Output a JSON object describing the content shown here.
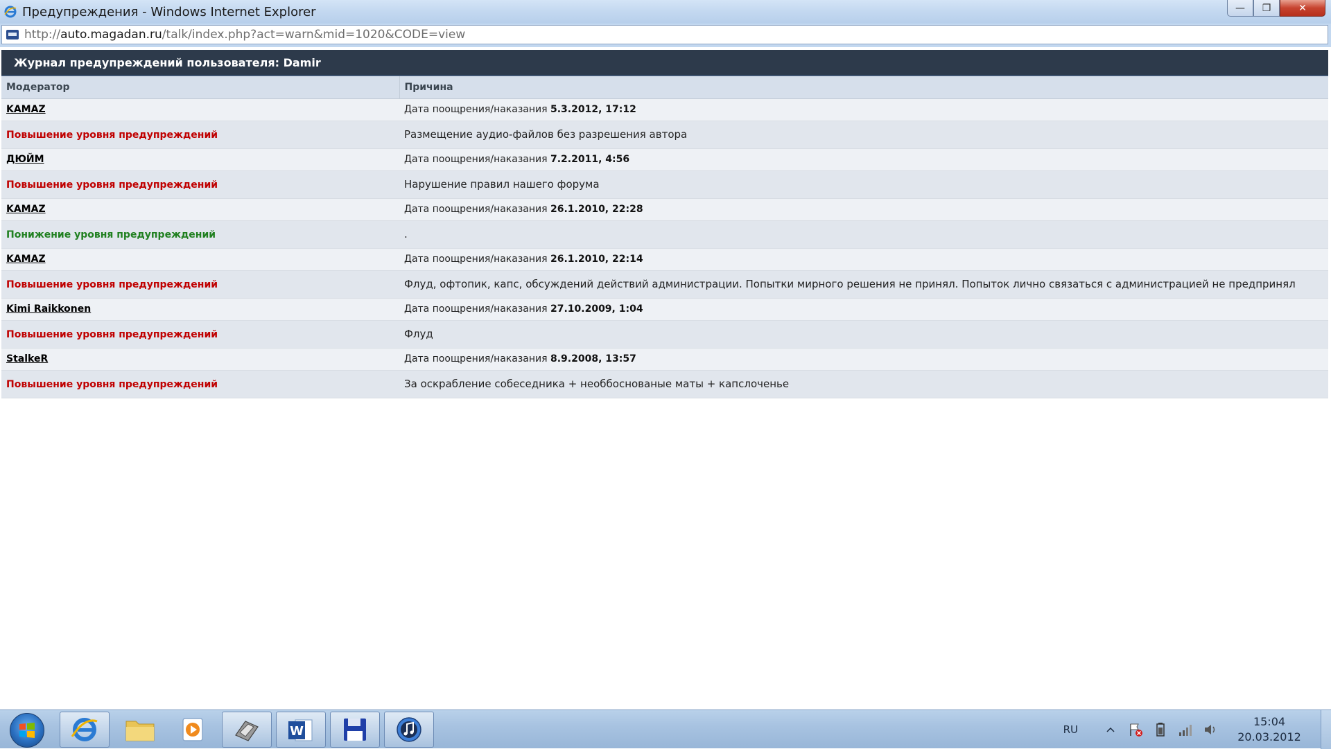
{
  "window": {
    "title": "Предупреждения - Windows Internet Explorer",
    "controls": {
      "minimize": "—",
      "maximize": "❐",
      "close": "✕"
    }
  },
  "address": {
    "prefix": "http://",
    "host": "auto.magadan.ru",
    "path": "/talk/index.php?act=warn&mid=1020&CODE=view"
  },
  "log": {
    "title": "Журнал предупреждений пользователя: Damir",
    "columns": {
      "moderator": "Модератор",
      "reason": "Причина"
    },
    "date_label": "Дата поощрения/наказания",
    "entries": [
      {
        "moderator": "KAMAZ",
        "date": "5.3.2012, 17:12",
        "action": "Повышение уровня предупреждений",
        "reason": "Размещение аудио-файлов без разрешения автора"
      },
      {
        "moderator": "ДЮЙМ",
        "date": "7.2.2011, 4:56",
        "action": "Повышение уровня предупреждений",
        "reason": "Нарушение правил нашего форума"
      },
      {
        "moderator": "KAMAZ",
        "date": "26.1.2010, 22:28",
        "action": "Понижение уровня предупреждений",
        "reason": "."
      },
      {
        "moderator": "KAMAZ",
        "date": "26.1.2010, 22:14",
        "action": "Повышение уровня предупреждений",
        "reason": "Флуд, офтопик, капс, обсуждений действий администрации. Попытки мирного решения не принял. Попыток лично связаться с администрацией не предпринял"
      },
      {
        "moderator": "Kimi Raikkonen",
        "date": "27.10.2009, 1:04",
        "action": "Повышение уровня предупреждений",
        "reason": "Флуд"
      },
      {
        "moderator": "StalkeR",
        "date": "8.9.2008, 13:57",
        "action": "Повышение уровня предупреждений",
        "reason": "За оскрабление собеседника + необбоснованые маты + капслоченье"
      }
    ]
  },
  "taskbar": {
    "language": "RU",
    "time": "15:04",
    "date": "20.03.2012"
  },
  "colors": {
    "action_up": "#c00000",
    "action_down": "#208020",
    "header_bg": "#2d3a4b"
  }
}
